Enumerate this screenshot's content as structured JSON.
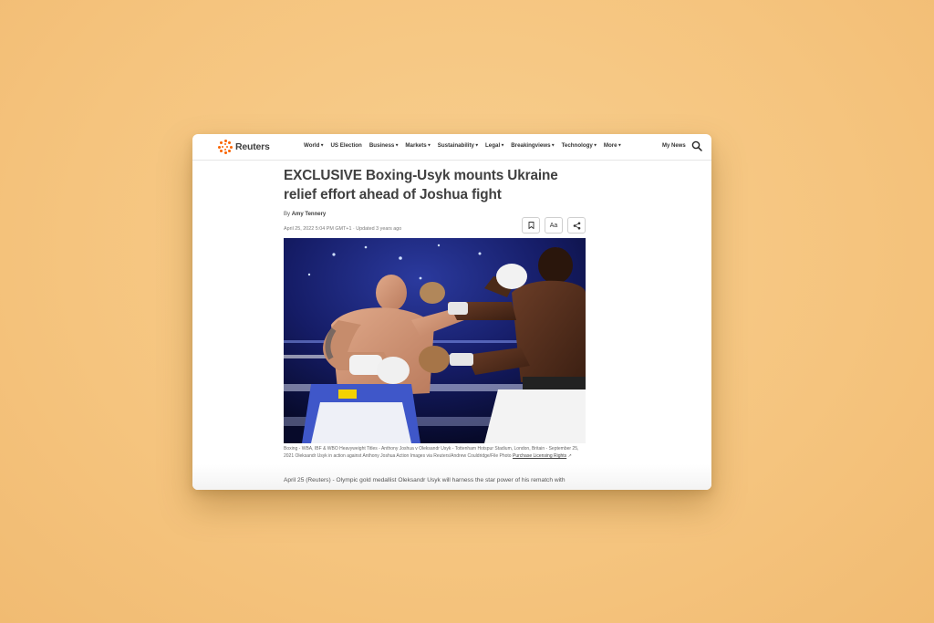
{
  "header": {
    "logo_text": "Reuters",
    "nav": [
      {
        "label": "World",
        "chevron": true
      },
      {
        "label": "US Election",
        "chevron": false
      },
      {
        "label": "Business",
        "chevron": true
      },
      {
        "label": "Markets",
        "chevron": true
      },
      {
        "label": "Sustainability",
        "chevron": true
      },
      {
        "label": "Legal",
        "chevron": true
      },
      {
        "label": "Breakingviews",
        "chevron": true
      },
      {
        "label": "Technology",
        "chevron": true
      },
      {
        "label": "More",
        "chevron": true
      }
    ],
    "my_news": "My News",
    "search_icon": "search-icon"
  },
  "article": {
    "headline": "EXCLUSIVE Boxing-Usyk mounts Ukraine relief effort ahead of Joshua fight",
    "byline_prefix": "By",
    "author": "Amy Tennery",
    "dateline": "April 25, 2022 5:04 PM GMT+1 · Updated 3 years ago",
    "tools": {
      "bookmark_icon": "bookmark-icon",
      "text_size_label": "Aa",
      "share_icon": "share-icon"
    },
    "caption": "Boxing - WBA, IBF & WBO Heavyweight Titles - Anthony Joshua v Oleksandr Usyk - Tottenham Hotspur Stadium, London, Britain - September 25, 2021 Oleksandr Usyk in action against Anthony Joshua Action Images via Reuters/Andrew Couldridge/File Photo",
    "caption_link": "Purchase Licensing Rights",
    "lede": "April 25 (Reuters) - Olympic gold medallist Oleksandr Usyk will harness the star power of his rematch with"
  },
  "colors": {
    "background": "#f5c47e",
    "brand_orange": "#fa6400",
    "text_dark": "#404040"
  }
}
